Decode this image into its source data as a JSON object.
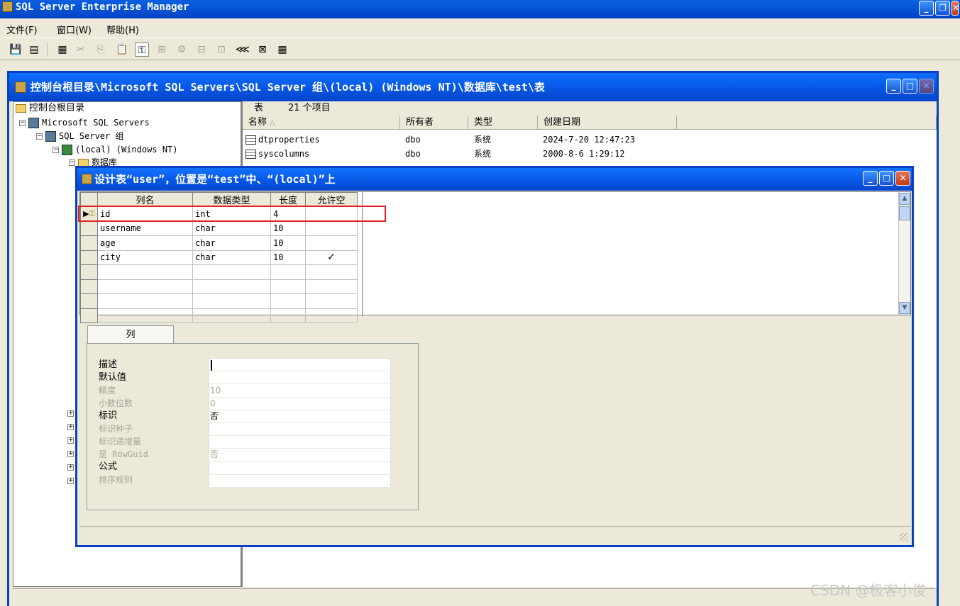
{
  "app": {
    "title": "SQL Server Enterprise Manager"
  },
  "menu": {
    "items": [
      "文件(F)",
      "窗口(W)",
      "帮助(H)"
    ]
  },
  "toolbar": {
    "icons": [
      "save-icon",
      "properties-icon",
      "server-icon",
      "cut-icon",
      "copy-icon",
      "paste-icon",
      "primary-key-icon",
      "relationships-icon",
      "manage-indexes-icon",
      "check-constraints-icon",
      "triggers-icon",
      "diagram-icon",
      "show-sql-icon",
      "grid-icon"
    ]
  },
  "console": {
    "title": "控制台根目录\\Microsoft SQL Servers\\SQL Server 组\\(local) (Windows NT)\\数据库\\test\\表",
    "tree": [
      {
        "label": "控制台根目录",
        "level": 0
      },
      {
        "label": "Microsoft SQL Servers",
        "level": 1
      },
      {
        "label": "SQL Server 组",
        "level": 2
      },
      {
        "label": "(local) (Windows NT)",
        "level": 3
      },
      {
        "label": "数据库",
        "level": 4
      }
    ],
    "list_header": {
      "prefix": "表",
      "count": "21 个项目"
    },
    "columns": [
      "名称",
      "所有者",
      "类型",
      "创建日期"
    ],
    "rows": [
      {
        "name": "dtproperties",
        "owner": "dbo",
        "type": "系统",
        "created": "2024-7-20 12:47:23"
      },
      {
        "name": "syscolumns",
        "owner": "dbo",
        "type": "系统",
        "created": "2000-8-6 1:29:12"
      }
    ]
  },
  "dialog": {
    "title": "设计表“user”，位置是“test”中、“(local)”上",
    "grid": {
      "headers": [
        "列名",
        "数据类型",
        "长度",
        "允许空"
      ],
      "rows": [
        {
          "name": "id",
          "type": "int",
          "length": "4",
          "nullable": "",
          "primary_key": true
        },
        {
          "name": "username",
          "type": "char",
          "length": "10",
          "nullable": ""
        },
        {
          "name": "age",
          "type": "char",
          "length": "10",
          "nullable": ""
        },
        {
          "name": "city",
          "type": "char",
          "length": "10",
          "nullable": "✓"
        }
      ]
    },
    "tab_label": "列",
    "properties": [
      {
        "label": "描述",
        "value": "",
        "enabled": true
      },
      {
        "label": "默认值",
        "value": "",
        "enabled": true
      },
      {
        "label": "精度",
        "value": "10",
        "enabled": false
      },
      {
        "label": "小数位数",
        "value": "0",
        "enabled": false
      },
      {
        "label": "标识",
        "value": "否",
        "enabled": true
      },
      {
        "label": "标识种子",
        "value": "",
        "enabled": false
      },
      {
        "label": "标识递增量",
        "value": "",
        "enabled": false
      },
      {
        "label": "是 RowGuid",
        "value": "否",
        "enabled": false
      },
      {
        "label": "公式",
        "value": "",
        "enabled": true
      },
      {
        "label": "排序规则",
        "value": "",
        "enabled": false
      }
    ]
  },
  "watermark": "CSDN @极客小俊"
}
